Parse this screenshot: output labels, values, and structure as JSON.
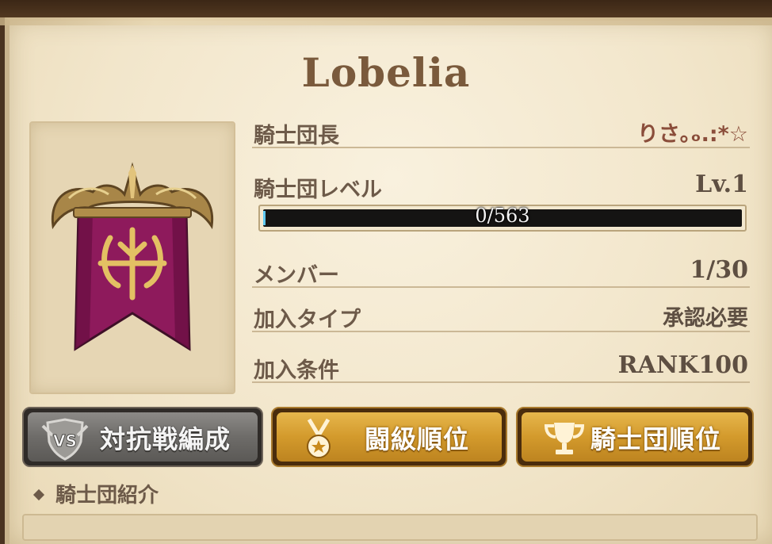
{
  "guild": {
    "name": "Lobelia",
    "banner_icon": "guild-banner-emblem",
    "banner_color": "#8e1a5c"
  },
  "info": {
    "leader_label": "騎士団長",
    "leader_value": "りさ｡ₒ.:*☆",
    "level_label": "騎士団レベル",
    "level_value": "Lv.1",
    "xp_text": "0/563",
    "xp_progress": 0,
    "members_label": "メンバー",
    "members_value": "1/30",
    "join_type_label": "加入タイプ",
    "join_type_value": "承認必要",
    "join_cond_label": "加入条件",
    "join_cond_value": "RANK100"
  },
  "buttons": {
    "versus_label": "対抗戦編成",
    "versus_icon": "vs-shield-icon",
    "rank_label": "闘級順位",
    "rank_icon": "medal-icon",
    "team_rank_label": "騎士団順位",
    "team_rank_icon": "trophy-icon"
  },
  "section": {
    "intro_title": "騎士団紹介"
  },
  "colors": {
    "parchment": "#f2e6cb",
    "gold_button": "#d39a2c",
    "gray_button": "#6e6c69",
    "text_brown": "#6d5a49"
  }
}
